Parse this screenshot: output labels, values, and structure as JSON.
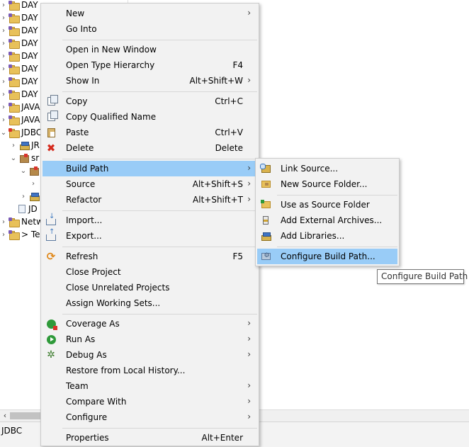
{
  "tree": {
    "projects": [
      {
        "label": "DAY",
        "kind": "project"
      },
      {
        "label": "DAY",
        "kind": "project"
      },
      {
        "label": "DAY",
        "kind": "project"
      },
      {
        "label": "DAY",
        "kind": "project"
      },
      {
        "label": "DAY",
        "kind": "project"
      },
      {
        "label": "DAY",
        "kind": "project"
      },
      {
        "label": "DAY",
        "kind": "project"
      },
      {
        "label": "DAY",
        "kind": "project"
      },
      {
        "label": "JAVA",
        "kind": "project"
      },
      {
        "label": "JAVA",
        "kind": "project"
      },
      {
        "label": "JDBC",
        "kind": "project-error"
      },
      {
        "label": "JR",
        "kind": "library"
      },
      {
        "label": "sr",
        "kind": "package-error"
      },
      {
        "label": "",
        "kind": "package-error"
      },
      {
        "label": "",
        "kind": "plain"
      },
      {
        "label": "",
        "kind": "library"
      },
      {
        "label": "JD",
        "kind": "file"
      },
      {
        "label": "Netw",
        "kind": "project"
      },
      {
        "label": "> Te",
        "kind": "project"
      }
    ]
  },
  "main_menu": {
    "items": [
      {
        "label": "New",
        "accel": "",
        "submenu": true,
        "icon": ""
      },
      {
        "label": "Go Into",
        "accel": "",
        "submenu": false,
        "icon": ""
      },
      {
        "label": "Open in New Window",
        "accel": "",
        "submenu": false,
        "icon": ""
      },
      {
        "label": "Open Type Hierarchy",
        "accel": "F4",
        "submenu": false,
        "icon": ""
      },
      {
        "label": "Show In",
        "accel": "Alt+Shift+W",
        "submenu": true,
        "icon": ""
      },
      {
        "label": "Copy",
        "accel": "Ctrl+C",
        "submenu": false,
        "icon": "copy-icon"
      },
      {
        "label": "Copy Qualified Name",
        "accel": "",
        "submenu": false,
        "icon": "copy-qualified-icon"
      },
      {
        "label": "Paste",
        "accel": "Ctrl+V",
        "submenu": false,
        "icon": "paste-icon"
      },
      {
        "label": "Delete",
        "accel": "Delete",
        "submenu": false,
        "icon": "delete-icon"
      },
      {
        "label": "Build Path",
        "accel": "",
        "submenu": true,
        "icon": ""
      },
      {
        "label": "Source",
        "accel": "Alt+Shift+S",
        "submenu": true,
        "icon": ""
      },
      {
        "label": "Refactor",
        "accel": "Alt+Shift+T",
        "submenu": true,
        "icon": ""
      },
      {
        "label": "Import...",
        "accel": "",
        "submenu": false,
        "icon": "import-icon"
      },
      {
        "label": "Export...",
        "accel": "",
        "submenu": false,
        "icon": "export-icon"
      },
      {
        "label": "Refresh",
        "accel": "F5",
        "submenu": false,
        "icon": "refresh-icon"
      },
      {
        "label": "Close Project",
        "accel": "",
        "submenu": false,
        "icon": ""
      },
      {
        "label": "Close Unrelated Projects",
        "accel": "",
        "submenu": false,
        "icon": ""
      },
      {
        "label": "Assign Working Sets...",
        "accel": "",
        "submenu": false,
        "icon": ""
      },
      {
        "label": "Coverage As",
        "accel": "",
        "submenu": true,
        "icon": "coverage-icon"
      },
      {
        "label": "Run As",
        "accel": "",
        "submenu": true,
        "icon": "run-icon"
      },
      {
        "label": "Debug As",
        "accel": "",
        "submenu": true,
        "icon": "debug-icon"
      },
      {
        "label": "Restore from Local History...",
        "accel": "",
        "submenu": false,
        "icon": ""
      },
      {
        "label": "Team",
        "accel": "",
        "submenu": true,
        "icon": ""
      },
      {
        "label": "Compare With",
        "accel": "",
        "submenu": true,
        "icon": ""
      },
      {
        "label": "Configure",
        "accel": "",
        "submenu": true,
        "icon": ""
      },
      {
        "label": "Properties",
        "accel": "Alt+Enter",
        "submenu": false,
        "icon": ""
      }
    ],
    "highlighted": "Build Path"
  },
  "build_path_menu": {
    "items": [
      {
        "label": "Link Source...",
        "icon": "link-source-icon"
      },
      {
        "label": "New Source Folder...",
        "icon": "source-folder-icon"
      },
      {
        "label": "Use as Source Folder",
        "icon": "use-source-folder-icon"
      },
      {
        "label": "Add External Archives...",
        "icon": "jar-icon"
      },
      {
        "label": "Add Libraries...",
        "icon": "library-icon"
      },
      {
        "label": "Configure Build Path...",
        "icon": "configure-build-path-icon"
      }
    ],
    "highlighted": "Configure Build Path..."
  },
  "tooltip": {
    "text": "Configure Build Path"
  },
  "status_bar": {
    "text": "JDBC"
  },
  "colors": {
    "highlight": "#99ccf7",
    "menu_bg": "#f2f2f2"
  }
}
